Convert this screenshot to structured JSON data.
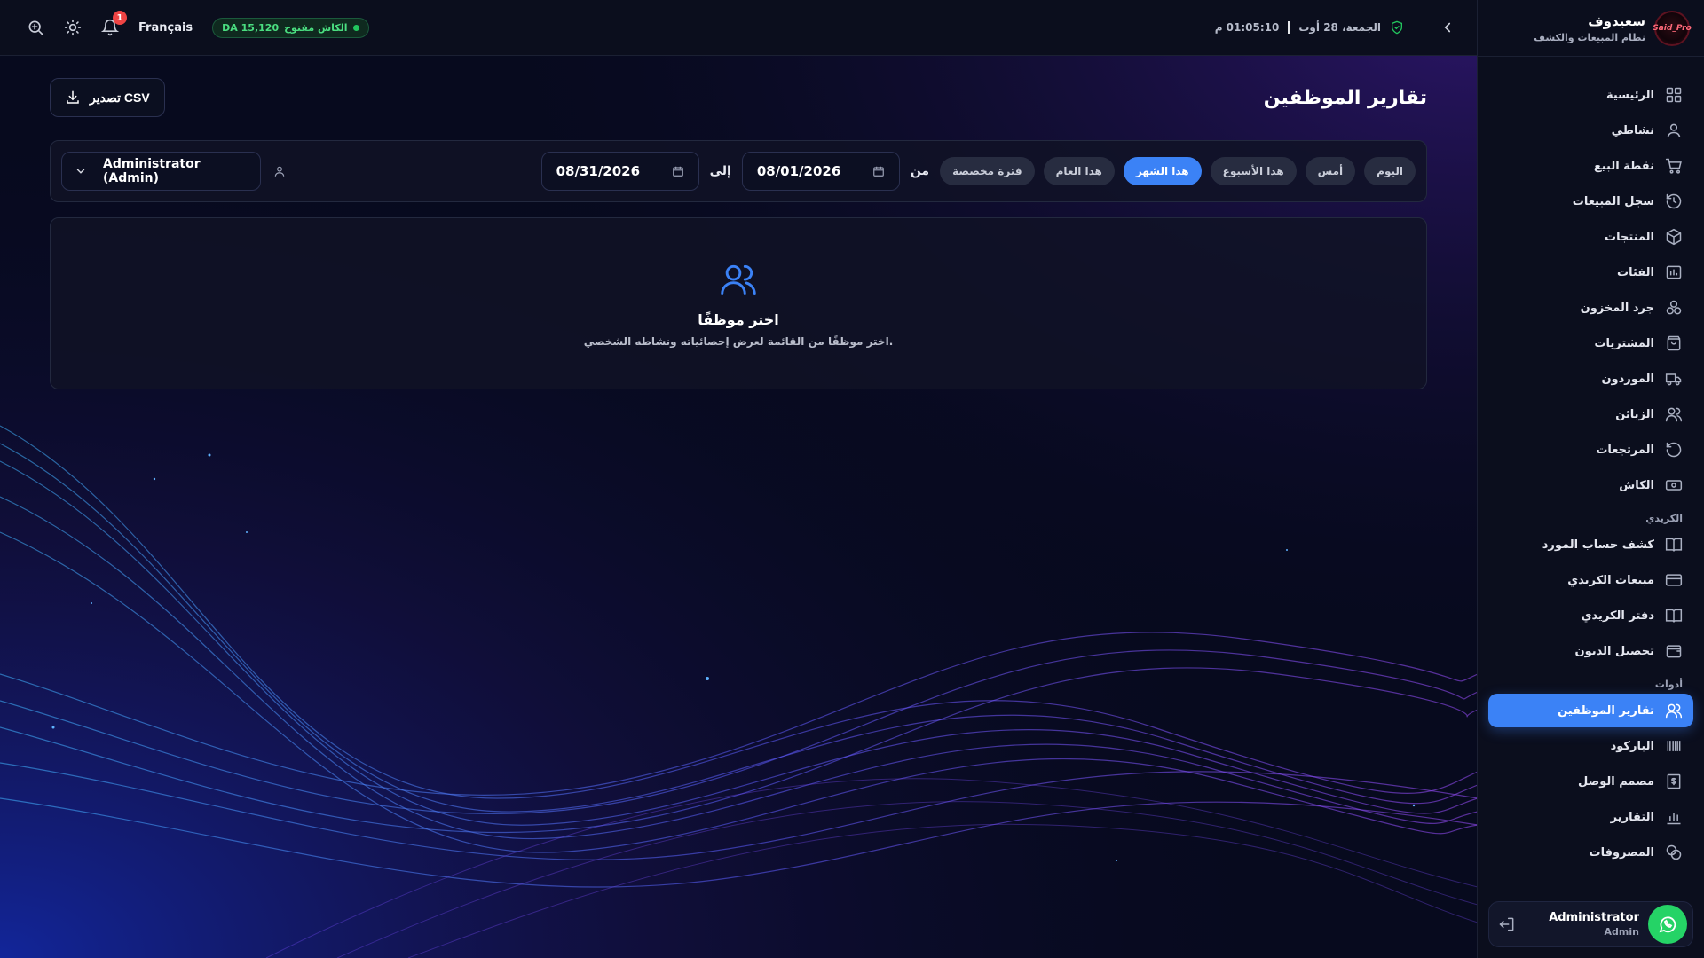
{
  "brand": {
    "name": "سعيدوف",
    "subtitle": "نظام المبيعات والكشف",
    "logo_text": "Said_Pro"
  },
  "topbar": {
    "language": "Français",
    "cash_status": "الكاش مفتوح",
    "cash_amount": "DA 15,120",
    "notification_count": "1",
    "date": "الجمعة، 28 أوت",
    "time": "01:05:10 م"
  },
  "page": {
    "title": "تقارير الموظفين",
    "export_label": "تصدير CSV"
  },
  "filters": {
    "ranges": [
      {
        "label": "اليوم"
      },
      {
        "label": "أمس"
      },
      {
        "label": "هذا الأسبوع"
      },
      {
        "label": "هذا الشهر",
        "active": true
      },
      {
        "label": "هذا العام"
      },
      {
        "label": "فترة مخصصة"
      }
    ],
    "from_label": "من",
    "to_label": "إلى",
    "from_date": "08/01/2026",
    "to_date": "08/31/2026",
    "employee": "Administrator (Admin)"
  },
  "empty_state": {
    "title": "اختر موظفًا",
    "subtitle": "اختر موظفًا من القائمة لعرض إحصائياته ونشاطه الشخصي."
  },
  "sidebar": {
    "items": [
      {
        "label": "الرئيسية",
        "icon": "grid-icon"
      },
      {
        "label": "نشاطي",
        "icon": "user-icon"
      },
      {
        "label": "نقطة البيع",
        "icon": "cart-icon"
      },
      {
        "label": "سجل المبيعات",
        "icon": "history-icon"
      },
      {
        "label": "المنتجات",
        "icon": "box-icon"
      },
      {
        "label": "الفئات",
        "icon": "folder-icon"
      },
      {
        "label": "جرد المخزون",
        "icon": "stock-icon"
      },
      {
        "label": "المشتريات",
        "icon": "bag-icon"
      },
      {
        "label": "الموردون",
        "icon": "truck-icon"
      },
      {
        "label": "الزبائن",
        "icon": "users-icon"
      },
      {
        "label": "المرتجعات",
        "icon": "return-icon"
      },
      {
        "label": "الكاش",
        "icon": "cash-icon"
      }
    ],
    "credit_section": "الكريدي",
    "credit_items": [
      {
        "label": "كشف حساب المورد",
        "icon": "book-icon"
      },
      {
        "label": "مبيعات الكريدي",
        "icon": "card-icon"
      },
      {
        "label": "دفتر الكريدي",
        "icon": "book-open-icon"
      },
      {
        "label": "تحصيل الديون",
        "icon": "wallet-icon"
      }
    ],
    "tools_section": "أدوات",
    "tools_items": [
      {
        "label": "تقارير الموظفين",
        "icon": "users-icon",
        "active": true
      },
      {
        "label": "الباركود",
        "icon": "barcode-icon"
      },
      {
        "label": "مصمم الوصل",
        "icon": "receipt-icon"
      },
      {
        "label": "التقارير",
        "icon": "chart-icon"
      },
      {
        "label": "المصروفات",
        "icon": "coins-icon"
      }
    ],
    "user": {
      "name": "Administrator",
      "role": "Admin"
    }
  },
  "colors": {
    "accent": "#3b82f6",
    "success": "#22c55e",
    "danger": "#ef4444"
  }
}
